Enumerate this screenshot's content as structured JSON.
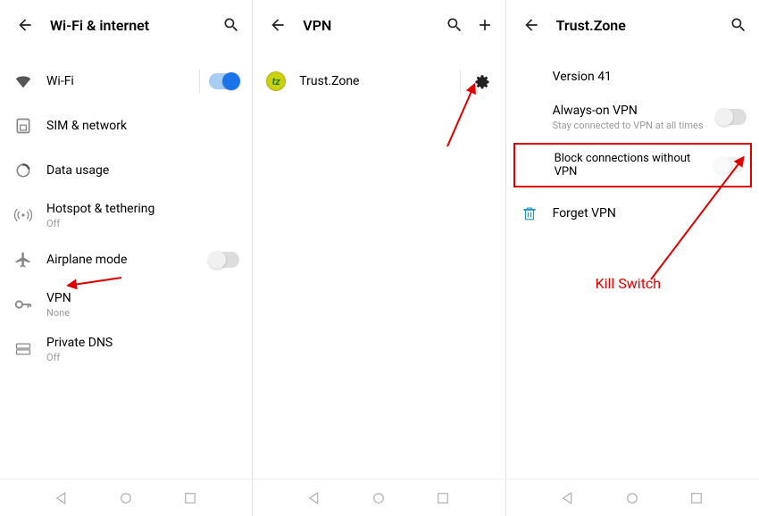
{
  "panel1": {
    "title": "Wi-Fi & internet",
    "items": [
      {
        "label": "Wi-Fi",
        "sub": "",
        "toggle": "on"
      },
      {
        "label": "SIM & network",
        "sub": ""
      },
      {
        "label": "Data usage",
        "sub": ""
      },
      {
        "label": "Hotspot & tethering",
        "sub": "Off"
      },
      {
        "label": "Airplane mode",
        "sub": "",
        "toggle": "off"
      },
      {
        "label": "VPN",
        "sub": "None"
      },
      {
        "label": "Private DNS",
        "sub": "Off"
      }
    ]
  },
  "panel2": {
    "title": "VPN",
    "entries": [
      {
        "name": "Trust.Zone"
      }
    ]
  },
  "panel3": {
    "title": "Trust.Zone",
    "version": "Version 41",
    "always_on_label": "Always-on VPN",
    "always_on_sub": "Stay connected to VPN at all times",
    "block_label": "Block connections without VPN",
    "forget_label": "Forget VPN"
  },
  "annotations": {
    "kill_switch": "Kill Switch"
  }
}
